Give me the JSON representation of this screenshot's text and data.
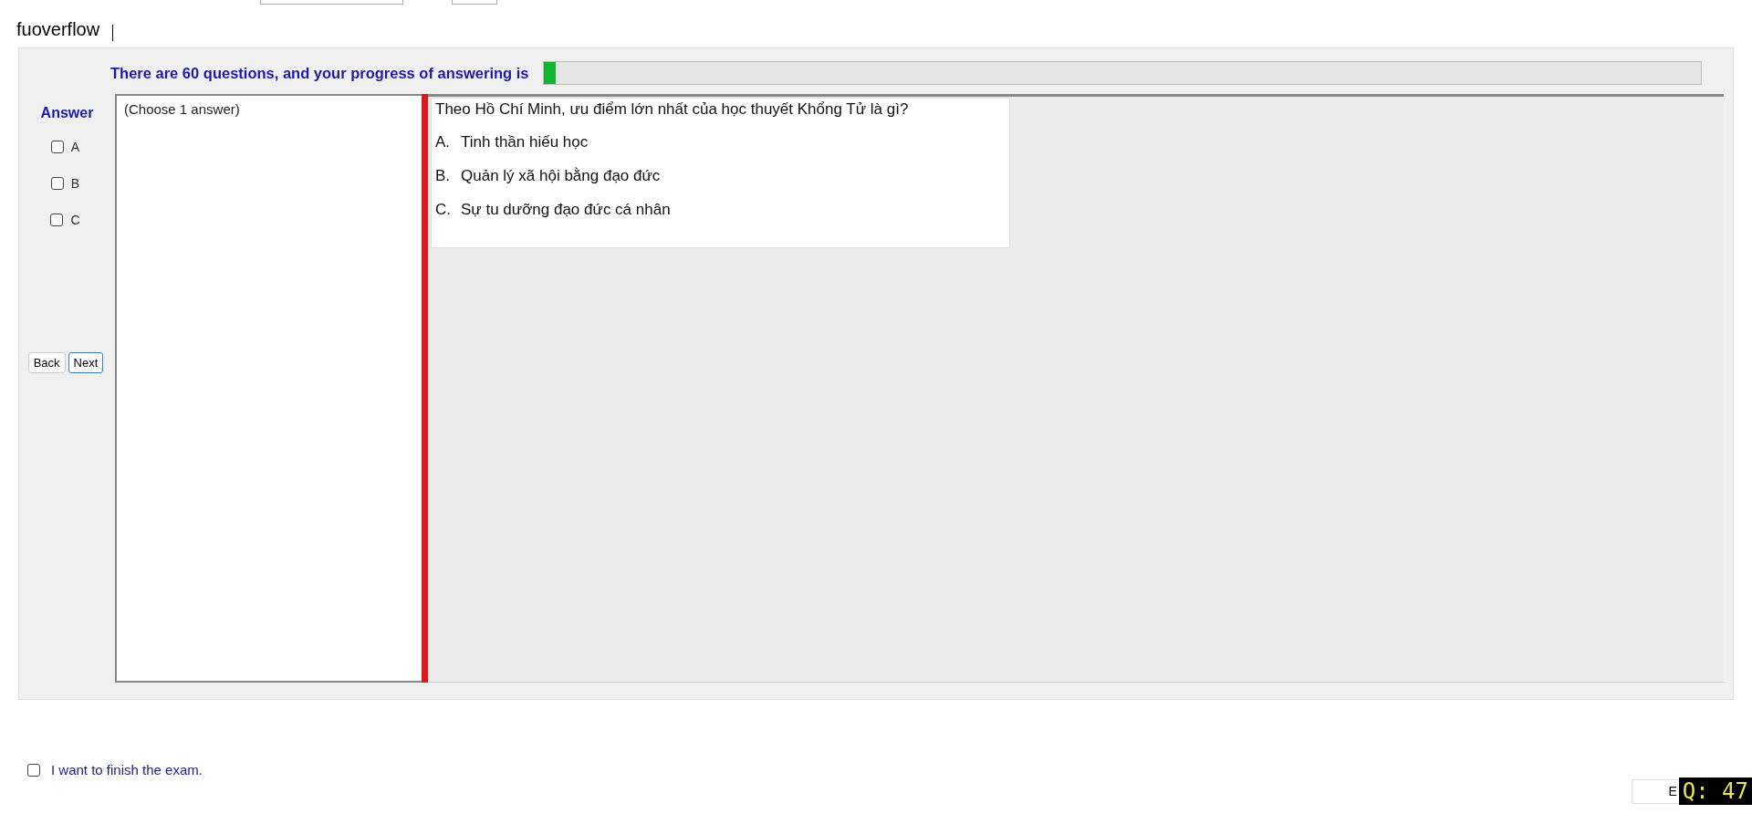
{
  "header": {
    "machine_label": "fuoverflow"
  },
  "progress": {
    "text": "There are 60 questions, and your progress of answering is",
    "level": 0.01
  },
  "answer_panel": {
    "title": "Answer",
    "options": [
      {
        "label": "A",
        "checked": false
      },
      {
        "label": "B",
        "checked": false
      },
      {
        "label": "C",
        "checked": false
      }
    ],
    "buttons": [
      "Back",
      "Next"
    ]
  },
  "instruction": "(Choose 1 answer)",
  "question": {
    "text": "Theo Hồ Chí Minh, ưu điểm lớn nhất của học thuyết Khổng Tử là gì?",
    "options": [
      {
        "letter": "A.",
        "text": "Tinh thần hiếu học"
      },
      {
        "letter": "B.",
        "text": "Quản lý xã hội bằng đạo đức"
      },
      {
        "letter": "C.",
        "text": "Sự tu dưỡng đạo đức cá nhân"
      }
    ]
  },
  "finish": {
    "label": "I want to finish the exam.",
    "checked": false
  },
  "footer": {
    "button": "E",
    "badge": "Q: 47"
  }
}
